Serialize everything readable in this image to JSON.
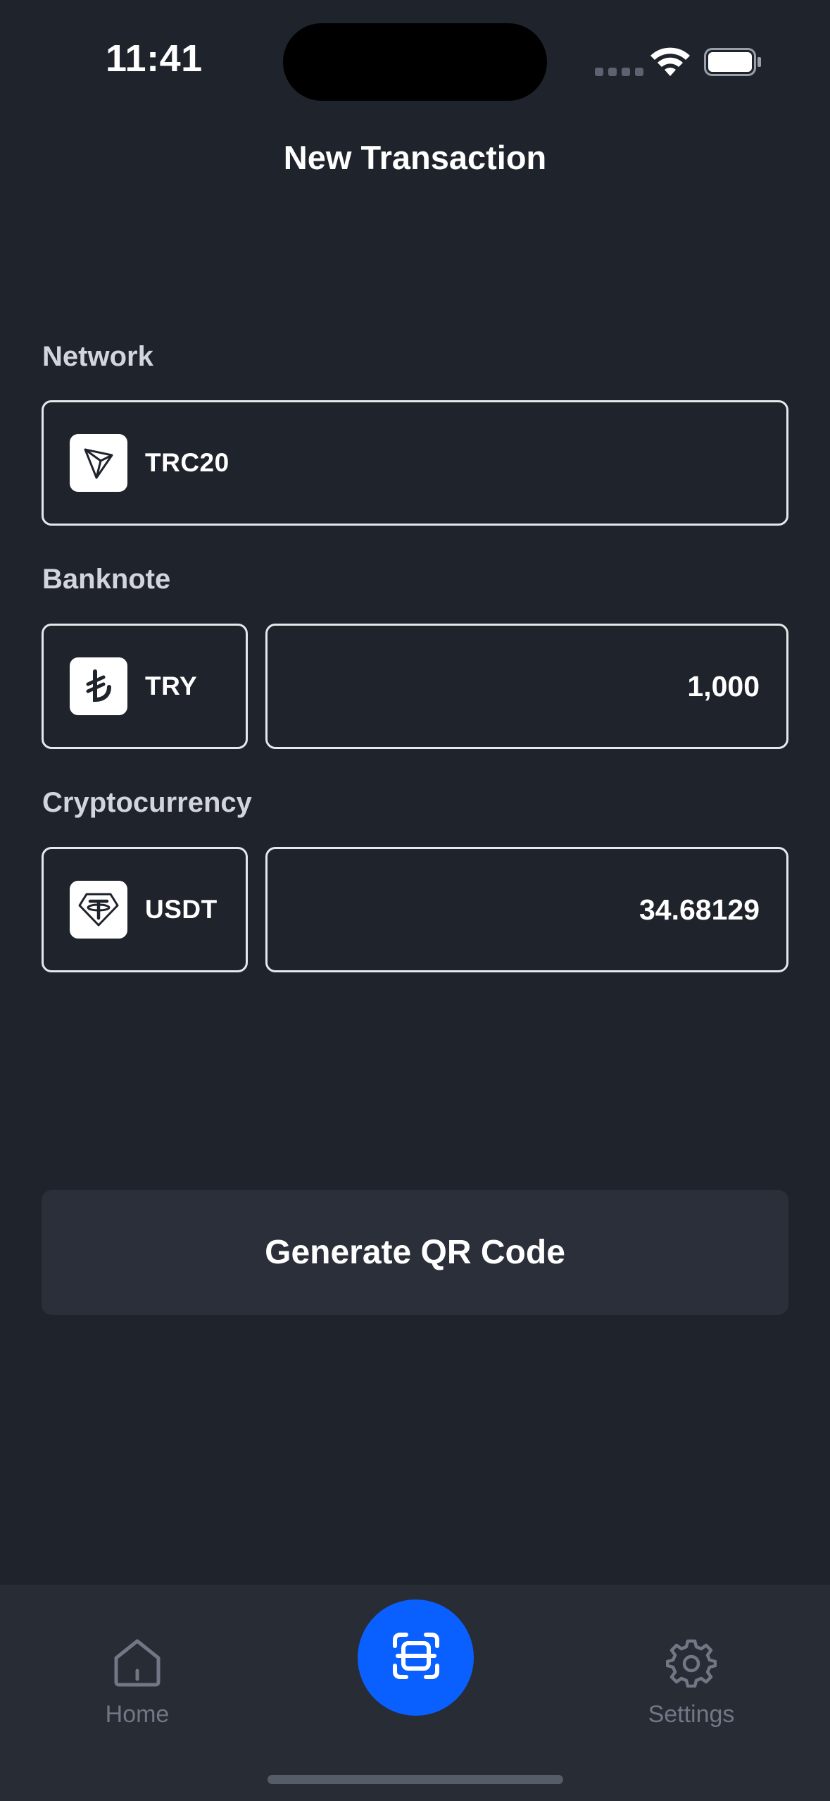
{
  "status_bar": {
    "time": "11:41"
  },
  "header": {
    "title": "New Transaction"
  },
  "network": {
    "label": "Network",
    "selected": "TRC20",
    "icon": "tron-icon"
  },
  "banknote": {
    "label": "Banknote",
    "currency": "TRY",
    "icon": "turkish-lira-icon",
    "amount": "1,000"
  },
  "crypto": {
    "label": "Cryptocurrency",
    "currency": "USDT",
    "icon": "tether-icon",
    "amount": "34.68129"
  },
  "actions": {
    "generate_label": "Generate QR Code"
  },
  "tabbar": {
    "home_label": "Home",
    "settings_label": "Settings",
    "scan_icon": "scan-icon"
  },
  "colors": {
    "background": "#1f232b",
    "accent": "#0a60ff",
    "button_bg": "#2a2f39",
    "tabbar_bg": "#272c35"
  }
}
